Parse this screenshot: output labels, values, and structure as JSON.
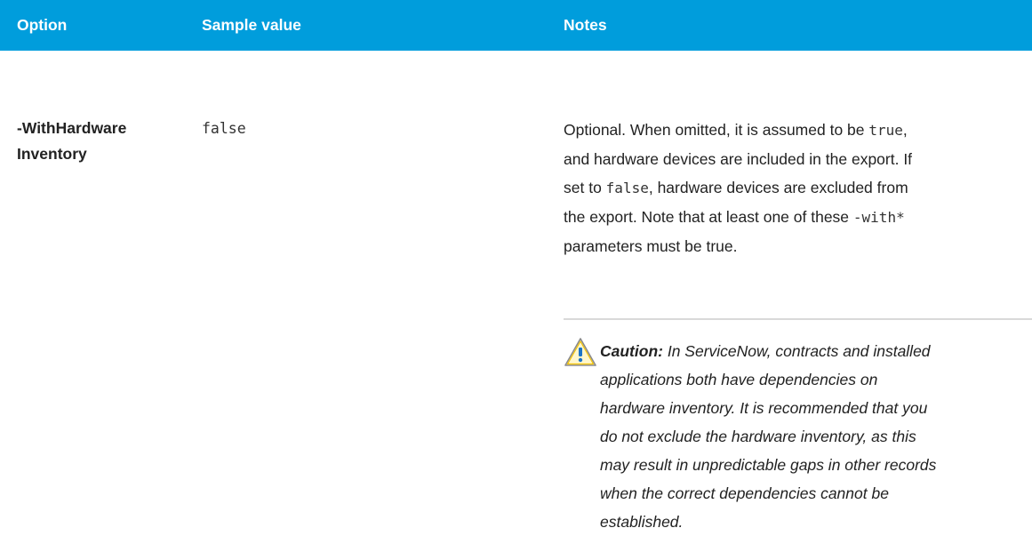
{
  "headers": {
    "option": "Option",
    "sample_value": "Sample value",
    "notes": "Notes"
  },
  "row": {
    "option_line1": "-WithHardware",
    "option_line2": "Inventory",
    "sample": "false",
    "notes": {
      "p1": "Optional. When omitted, it is assumed to be ",
      "code_true": "true",
      "p2": ",",
      "p3": "and hardware devices are included in the export. If",
      "p4": "set to ",
      "code_false": "false",
      "p5": ", hardware devices are excluded from",
      "p6": "the export. Note that at least one of these ",
      "code_with": "-with*",
      "p7": "parameters must be true."
    },
    "caution": {
      "label": "Caution:",
      "l1": " In ServiceNow, contracts and installed",
      "l2": "applications both have dependencies on",
      "l3": "hardware inventory. It is recommended that you",
      "l4": "do not exclude the hardware inventory, as this",
      "l5": "may result in unpredictable gaps in other records",
      "l6": "when the correct dependencies cannot be",
      "l7": "established.",
      "icon": "warning-triangle-icon"
    }
  },
  "colors": {
    "header_bg": "#009ddc",
    "header_text": "#ffffff",
    "divider": "#d9d9d9"
  }
}
